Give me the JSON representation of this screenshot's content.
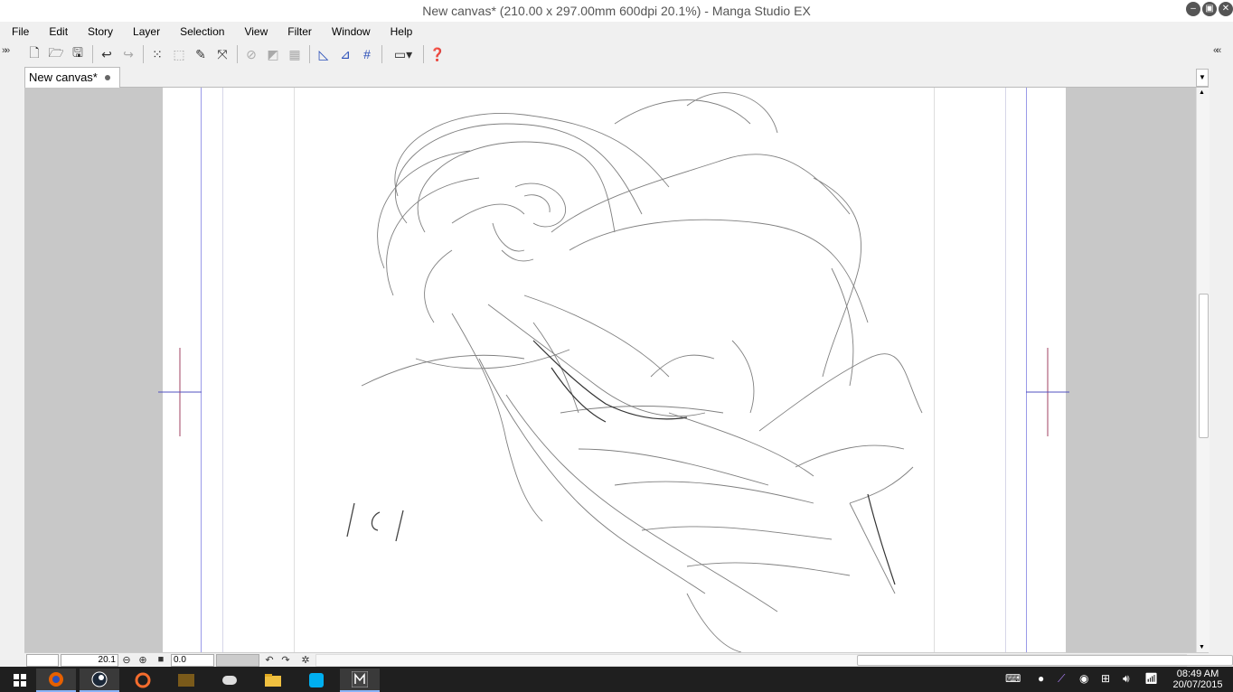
{
  "window": {
    "title": "New canvas* (210.00 x 297.00mm 600dpi 20.1%)  - Manga Studio EX"
  },
  "menu": [
    "File",
    "Edit",
    "Story",
    "Layer",
    "Selection",
    "View",
    "Filter",
    "Window",
    "Help"
  ],
  "tab": {
    "label": "New canvas*"
  },
  "status": {
    "zoom": "20.1",
    "rotation": "0.0"
  },
  "canvas": {
    "signature": "lcl"
  },
  "taskbar": {
    "time": "08:49 AM",
    "date": "20/07/2015"
  }
}
